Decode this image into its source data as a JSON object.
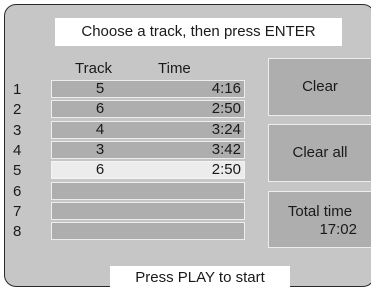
{
  "header": {
    "instruction": "Choose a track, then press ENTER"
  },
  "columns": {
    "track": "Track",
    "time": "Time"
  },
  "rows": [
    {
      "num": "1",
      "track": "5",
      "time": "4:16",
      "selected": false
    },
    {
      "num": "2",
      "track": "6",
      "time": "2:50",
      "selected": false
    },
    {
      "num": "3",
      "track": "4",
      "time": "3:24",
      "selected": false
    },
    {
      "num": "4",
      "track": "3",
      "time": "3:42",
      "selected": false
    },
    {
      "num": "5",
      "track": "6",
      "time": "2:50",
      "selected": true
    },
    {
      "num": "6",
      "track": "",
      "time": "",
      "selected": false
    },
    {
      "num": "7",
      "track": "",
      "time": "",
      "selected": false
    },
    {
      "num": "8",
      "track": "",
      "time": "",
      "selected": false
    }
  ],
  "buttons": {
    "clear": "Clear",
    "clear_all": "Clear all"
  },
  "total": {
    "label": "Total time",
    "value": "17:02"
  },
  "footer": {
    "hint": "Press PLAY to start"
  },
  "colors": {
    "panel": "#c6c6c6",
    "cell": "#aeaeae",
    "selected": "#ececec",
    "border": "#2a2a2a"
  }
}
